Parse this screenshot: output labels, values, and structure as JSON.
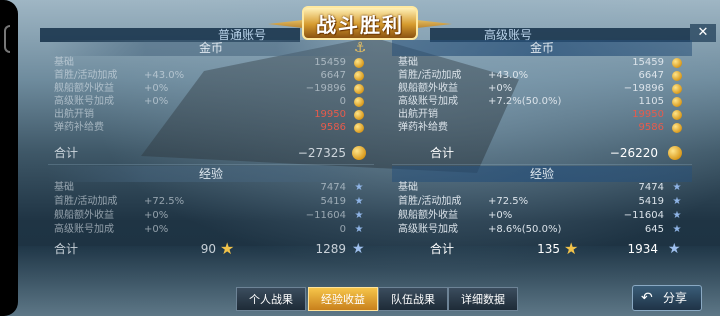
{
  "title": "战斗胜利",
  "close_label": "✕",
  "accounts": {
    "left": "普通账号",
    "right": "高级账号"
  },
  "left": {
    "gold": {
      "header": "金币",
      "rows": [
        {
          "label": "基础",
          "pct": "",
          "value": "15459",
          "red": false
        },
        {
          "label": "首胜/活动加成",
          "pct": "+43.0%",
          "value": "6647",
          "red": false
        },
        {
          "label": "舰船额外收益",
          "pct": "+0%",
          "value": "−19896",
          "red": false
        },
        {
          "label": "高级账号加成",
          "pct": "+0%",
          "value": "0",
          "red": false
        },
        {
          "label": "出航开销",
          "pct": "",
          "value": "19950",
          "red": true
        },
        {
          "label": "弹药补给费",
          "pct": "",
          "value": "9586",
          "red": true
        }
      ],
      "total_label": "合计",
      "total_value": "−27325"
    },
    "exp": {
      "header": "经验",
      "rows": [
        {
          "label": "基础",
          "pct": "",
          "value": "7474"
        },
        {
          "label": "首胜/活动加成",
          "pct": "+72.5%",
          "value": "5419"
        },
        {
          "label": "舰船额外收益",
          "pct": "+0%",
          "value": "−11604"
        },
        {
          "label": "高级账号加成",
          "pct": "+0%",
          "value": "0"
        }
      ],
      "total_label": "合计",
      "captain_exp": "90",
      "total_value": "1289"
    }
  },
  "right": {
    "gold": {
      "header": "金币",
      "rows": [
        {
          "label": "基础",
          "pct": "",
          "value": "15459",
          "red": false
        },
        {
          "label": "首胜/活动加成",
          "pct": "+43.0%",
          "value": "6647",
          "red": false
        },
        {
          "label": "舰船额外收益",
          "pct": "+0%",
          "value": "−19896",
          "red": false
        },
        {
          "label": "高级账号加成",
          "pct": "+7.2%(50.0%)",
          "value": "1105",
          "red": false
        },
        {
          "label": "出航开销",
          "pct": "",
          "value": "19950",
          "red": true
        },
        {
          "label": "弹药补给费",
          "pct": "",
          "value": "9586",
          "red": true
        }
      ],
      "total_label": "合计",
      "total_value": "−26220"
    },
    "exp": {
      "header": "经验",
      "rows": [
        {
          "label": "基础",
          "pct": "",
          "value": "7474"
        },
        {
          "label": "首胜/活动加成",
          "pct": "+72.5%",
          "value": "5419"
        },
        {
          "label": "舰船额外收益",
          "pct": "+0%",
          "value": "−11604"
        },
        {
          "label": "高级账号加成",
          "pct": "+8.6%(50.0%)",
          "value": "645"
        }
      ],
      "total_label": "合计",
      "captain_exp": "135",
      "total_value": "1934"
    }
  },
  "tabs": [
    {
      "label": "个人战果",
      "active": false
    },
    {
      "label": "经验收益",
      "active": true
    },
    {
      "label": "队伍战果",
      "active": false
    },
    {
      "label": "详细数据",
      "active": false
    }
  ],
  "share_label": "分享",
  "colors": {
    "gold": "#d99a1d",
    "negative": "#e65b4c",
    "active_tab": "#f6c54a",
    "star": "#8fb4e6"
  }
}
